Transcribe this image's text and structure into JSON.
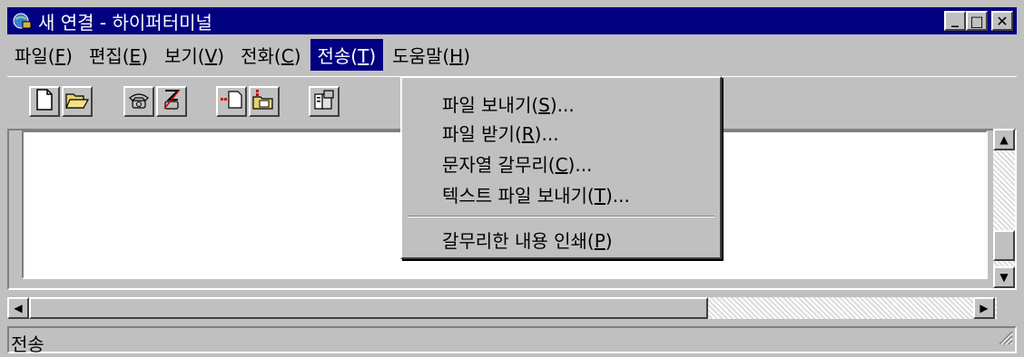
{
  "window": {
    "title": "새 연결 - 하이퍼터미널",
    "minimize_label": "_",
    "maximize_label": "□",
    "close_label": "✕"
  },
  "menubar": {
    "items": [
      {
        "label_pre": "파일(",
        "mnemonic": "F",
        "label_post": ")"
      },
      {
        "label_pre": "편집(",
        "mnemonic": "E",
        "label_post": ")"
      },
      {
        "label_pre": "보기(",
        "mnemonic": "V",
        "label_post": ")"
      },
      {
        "label_pre": "전화(",
        "mnemonic": "C",
        "label_post": ")"
      },
      {
        "label_pre": "전송(",
        "mnemonic": "T",
        "label_post": ")"
      },
      {
        "label_pre": "도움말(",
        "mnemonic": "H",
        "label_post": ")"
      }
    ],
    "active_index": 4
  },
  "toolbar": {
    "buttons": [
      {
        "icon": "new-icon"
      },
      {
        "icon": "open-folder-icon"
      },
      {
        "icon": "phone-connect-icon"
      },
      {
        "icon": "phone-disconnect-icon"
      },
      {
        "icon": "send-file-icon"
      },
      {
        "icon": "receive-file-icon"
      },
      {
        "icon": "properties-icon"
      }
    ]
  },
  "transfer_menu": {
    "items": [
      {
        "label_pre": "파일 보내기(",
        "mnemonic": "S",
        "label_post": ")..."
      },
      {
        "label_pre": "파일 받기(",
        "mnemonic": "R",
        "label_post": ")..."
      },
      {
        "label_pre": "문자열 갈무리(",
        "mnemonic": "C",
        "label_post": ")..."
      },
      {
        "label_pre": "텍스트 파일 보내기(",
        "mnemonic": "T",
        "label_post": ")..."
      },
      {
        "label_pre": "갈무리한 내용 인쇄(",
        "mnemonic": "P",
        "label_post": ")"
      }
    ]
  },
  "scrollbars": {
    "up_arrow": "▲",
    "down_arrow": "▼",
    "left_arrow": "◀",
    "right_arrow": "▶"
  },
  "statusbar": {
    "text": "전송"
  },
  "colors": {
    "titlebar": "#000080",
    "face": "#c0c0c0",
    "highlight": "#000080"
  }
}
